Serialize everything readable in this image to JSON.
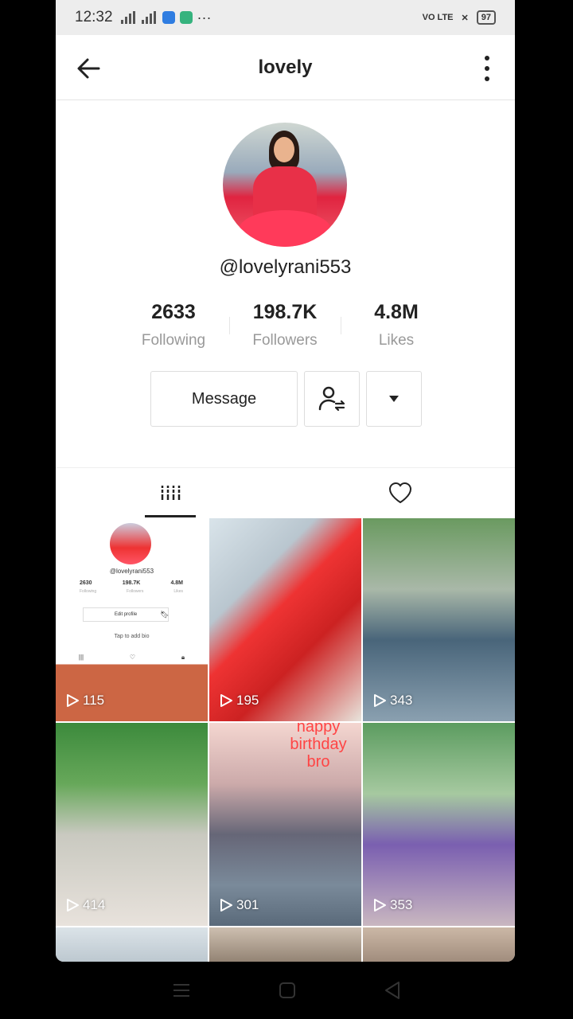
{
  "status_bar": {
    "time": "12:32",
    "network": "VO LTE",
    "battery": "97"
  },
  "header": {
    "title": "lovely"
  },
  "profile": {
    "username": "@lovelyrani553",
    "stats": [
      {
        "value": "2633",
        "label": "Following"
      },
      {
        "value": "198.7K",
        "label": "Followers"
      },
      {
        "value": "4.8M",
        "label": "Likes"
      }
    ],
    "message_label": "Message"
  },
  "tabs": [
    {
      "name": "videos",
      "icon": "grid-bars-icon",
      "active": true
    },
    {
      "name": "liked",
      "icon": "heart-outline-icon",
      "active": false
    }
  ],
  "videos": [
    {
      "views": "115",
      "thumbnail": {
        "username": "@lovelyrani553",
        "stats": [
          "2630",
          "198.7K",
          "4.8M"
        ],
        "stat_labels": [
          "Following",
          "Followers",
          "Likes"
        ],
        "edit_label": "Edit profile",
        "bio_hint": "Tap to add bio"
      }
    },
    {
      "views": "195"
    },
    {
      "views": "343"
    },
    {
      "views": "414"
    },
    {
      "views": "301",
      "caption": "happy birthday bro"
    },
    {
      "views": "353"
    }
  ],
  "colors": {
    "background": "#000000",
    "card": "#ffffff",
    "text_primary": "#222222",
    "text_secondary": "#999999"
  }
}
